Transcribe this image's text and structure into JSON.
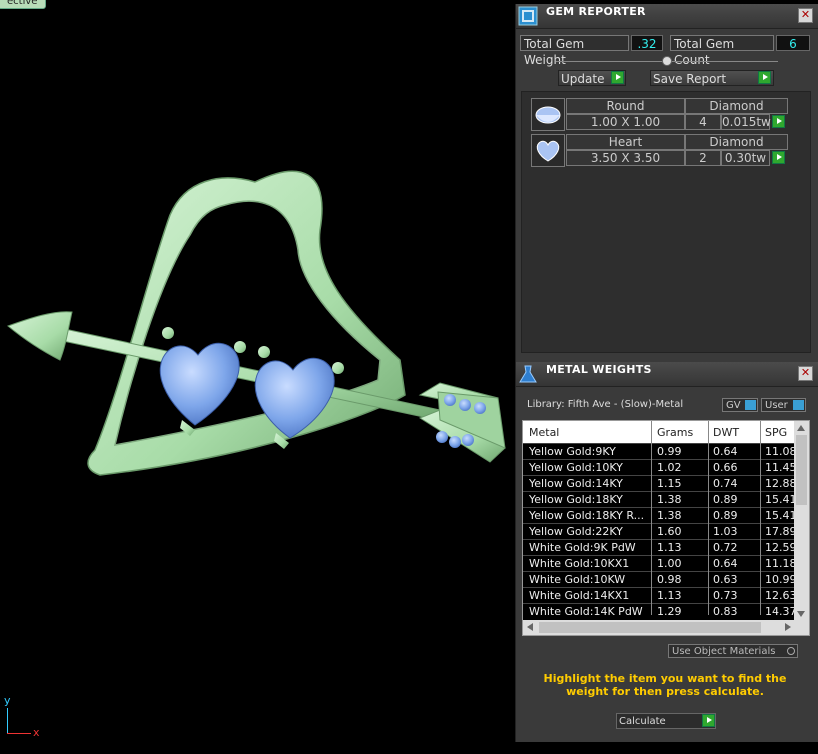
{
  "viewport": {
    "tab_label": "ective",
    "axis_y": "y",
    "axis_x": "x"
  },
  "gem_reporter": {
    "title": "GEM REPORTER",
    "total_weight_label": "Total Gem Weight",
    "total_weight_value": ".32",
    "total_count_label": "Total Gem Count",
    "total_count_value": "6",
    "update_label": "Update",
    "save_report_label": "Save Report",
    "gems": [
      {
        "shape": "Round",
        "type": "Diamond",
        "size": "1.00 X 1.00",
        "count": "4",
        "weight": "0.015tw"
      },
      {
        "shape": "Heart",
        "type": "Diamond",
        "size": "3.50 X 3.50",
        "count": "2",
        "weight": "0.30tw"
      }
    ]
  },
  "metal_weights": {
    "title": "METAL WEIGHTS",
    "library_label": "Library: Fifth Ave - (Slow)-Metal",
    "gv_label": "GV",
    "user_label": "User",
    "columns": [
      "Metal",
      "Grams",
      "DWT",
      "SPG"
    ],
    "rows": [
      [
        "Yellow Gold:9KY",
        "0.99",
        "0.64",
        "11.08"
      ],
      [
        "Yellow Gold:10KY",
        "1.02",
        "0.66",
        "11.45"
      ],
      [
        "Yellow Gold:14KY",
        "1.15",
        "0.74",
        "12.88"
      ],
      [
        "Yellow Gold:18KY",
        "1.38",
        "0.89",
        "15.41"
      ],
      [
        "Yellow Gold:18KY R...",
        "1.38",
        "0.89",
        "15.41"
      ],
      [
        "Yellow Gold:22KY",
        "1.60",
        "1.03",
        "17.89"
      ],
      [
        "White Gold:9K PdW",
        "1.13",
        "0.72",
        "12.59"
      ],
      [
        "White Gold:10KX1",
        "1.00",
        "0.64",
        "11.18"
      ],
      [
        "White Gold:10KW",
        "0.98",
        "0.63",
        "10.99"
      ],
      [
        "White Gold:14KX1",
        "1.13",
        "0.73",
        "12.63"
      ],
      [
        "White Gold:14K PdW",
        "1.29",
        "0.83",
        "14.37"
      ]
    ],
    "use_object_materials_label": "Use Object Materials",
    "instruction": "Highlight the item you want to find the weight for then press calculate.",
    "calculate_label": "Calculate"
  },
  "colors": {
    "metal": "#b5e3b5",
    "gem": "#7aa6e8",
    "instruction_text": "#ffcc00",
    "accent_green": "#2fa82f"
  }
}
